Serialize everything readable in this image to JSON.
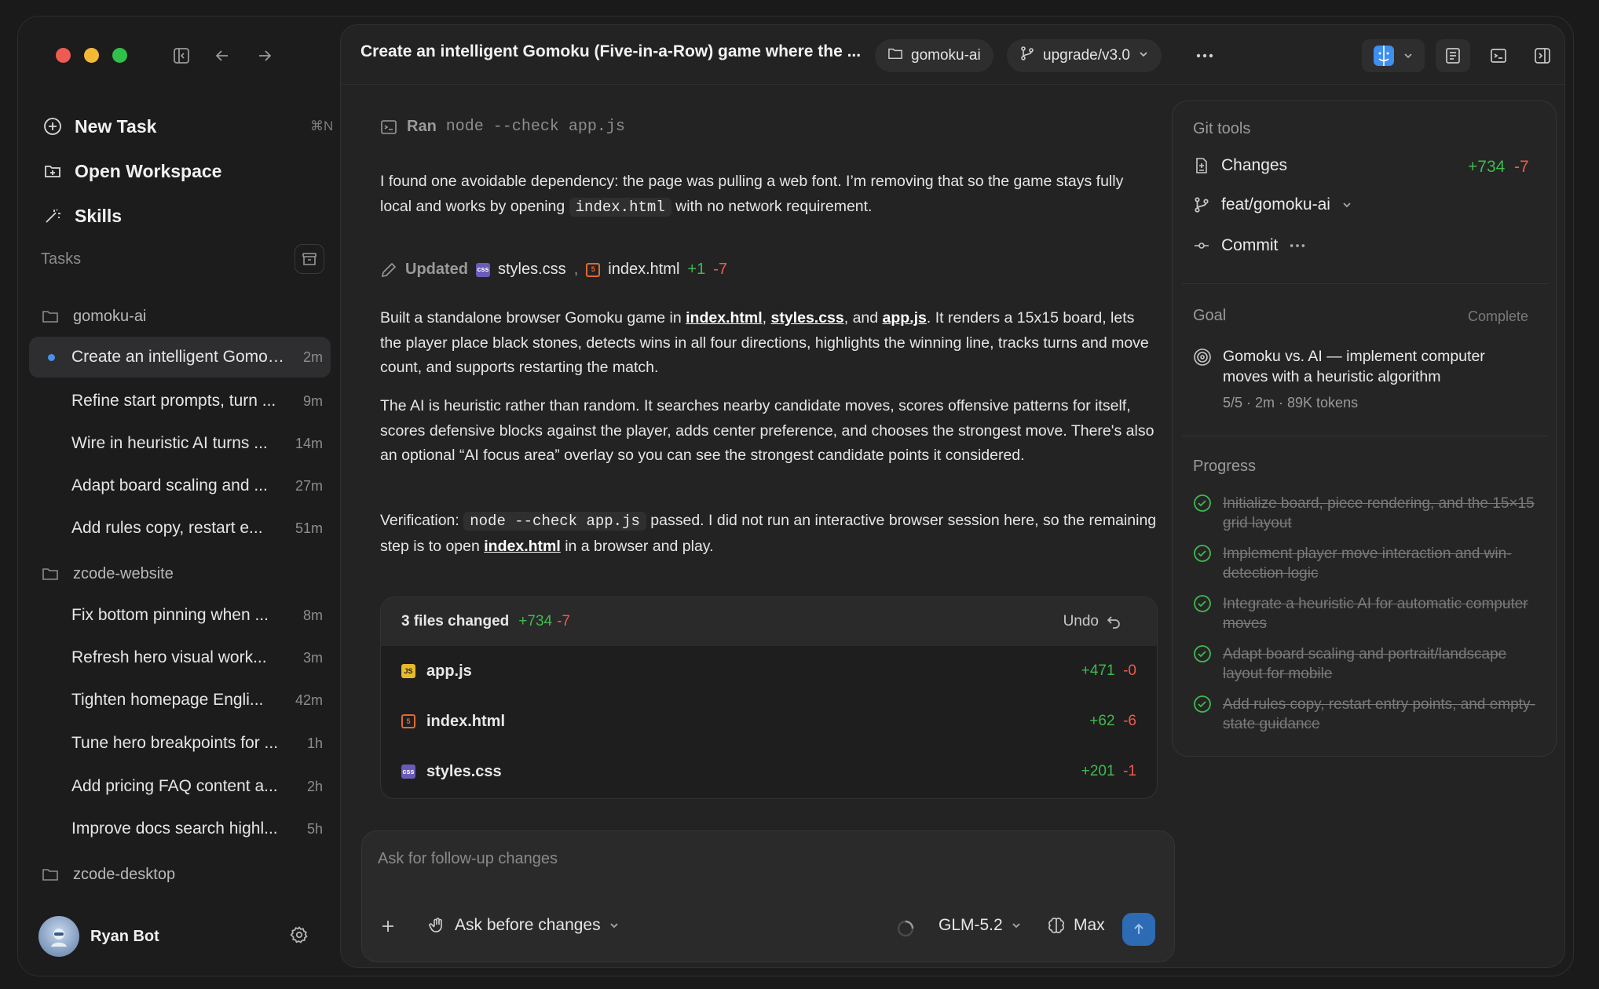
{
  "sidebar": {
    "new_task": "New Task",
    "new_task_shortcut": "⌘N",
    "open_workspace": "Open Workspace",
    "skills": "Skills",
    "tasks_header": "Tasks",
    "projects": [
      {
        "name": "gomoku-ai"
      },
      {
        "name": "zcode-website"
      },
      {
        "name": "zcode-desktop"
      }
    ],
    "tasks": [
      {
        "title": "Create an intelligent Gomoku (Five-in-a-Row) game where the ...",
        "time": "2m"
      },
      {
        "title": "Refine start prompts, turn ...",
        "time": "9m"
      },
      {
        "title": "Wire in heuristic AI turns ...",
        "time": "14m"
      },
      {
        "title": "Adapt board scaling and ...",
        "time": "27m"
      },
      {
        "title": "Add rules copy, restart e...",
        "time": "51m"
      },
      {
        "title": "Fix bottom pinning when ...",
        "time": "8m"
      },
      {
        "title": "Refresh hero visual work...",
        "time": "3m"
      },
      {
        "title": "Tighten homepage Engli...",
        "time": "42m"
      },
      {
        "title": "Tune hero breakpoints for ...",
        "time": "1h"
      },
      {
        "title": "Add pricing FAQ content a...",
        "time": "2h"
      },
      {
        "title": "Improve docs search highl...",
        "time": "5h"
      }
    ],
    "user_name": "Ryan Bot"
  },
  "topbar": {
    "title": "Create an intelligent Gomoku (Five-in-a-Row) game where the ...",
    "workspace": "gomoku-ai",
    "branch": "upgrade/v3.0"
  },
  "chat": {
    "ran_label": "Ran",
    "ran_command": "node --check app.js",
    "p1_a": "I found one avoidable dependency: the page was pulling a web font. I’m removing that so the game stays fully local and works by opening",
    "p1_code": "index.html",
    "p1_b": "with no network requirement.",
    "updated_label": "Updated",
    "updated_file1": "styles.css",
    "updated_file2": "index.html",
    "updated_add": "+1",
    "updated_del": "-7",
    "p2_a": "Built a standalone browser Gomoku game in",
    "p2_link1": "index.html",
    "p2_link2": "styles.css",
    "p2_and": ", and",
    "p2_link3": "app.js",
    "p2_b": ". It renders a 15x15 board, lets the player place black stones, detects wins in all four directions, highlights the winning line, tracks turns and move count, and supports restarting the match.",
    "p3": "The AI is heuristic rather than random. It searches nearby candidate moves, scores offensive patterns for itself, scores defensive blocks against the player, adds center preference, and chooses the strongest move. There's also an optional “AI focus area” overlay so you can see the strongest candidate points it considered.",
    "p4_a": "Verification:",
    "p4_code": "node --check app.js",
    "p4_b": "passed. I did not run an interactive browser session here, so the remaining step is to open",
    "p4_link": "index.html",
    "p4_c": "in a browser and play."
  },
  "files": {
    "header": "3 files changed",
    "add": "+734",
    "del": "-7",
    "undo": "Undo",
    "rows": [
      {
        "name": "app.js",
        "add": "+471",
        "del": "-0"
      },
      {
        "name": "index.html",
        "add": "+62",
        "del": "-6"
      },
      {
        "name": "styles.css",
        "add": "+201",
        "del": "-1"
      }
    ]
  },
  "input": {
    "placeholder": "Ask for follow-up changes",
    "mode": "Ask before changes",
    "model": "GLM-5.2",
    "effort": "Max"
  },
  "git": {
    "header": "Git tools",
    "changes": "Changes",
    "add": "+734",
    "del": "-7",
    "branch": "feat/gomoku-ai",
    "commit": "Commit"
  },
  "goal": {
    "header": "Goal",
    "status": "Complete",
    "title": "Gomoku vs. AI — implement computer moves with a heuristic algorithm",
    "meta": "5/5 · 2m · 89K tokens"
  },
  "progress": {
    "header": "Progress",
    "items": [
      "Initialize board, piece rendering, and the 15×15 grid layout",
      "Implement player move interaction and win-detection logic",
      "Integrate a heuristic AI for automatic computer moves",
      "Adapt board scaling and portrait/landscape layout for mobile",
      "Add rules copy, restart entry points, and empty-state guidance"
    ]
  },
  "colors": {
    "accent": "#2d6bb5",
    "add": "#3fb950",
    "del": "#f05a4d"
  }
}
